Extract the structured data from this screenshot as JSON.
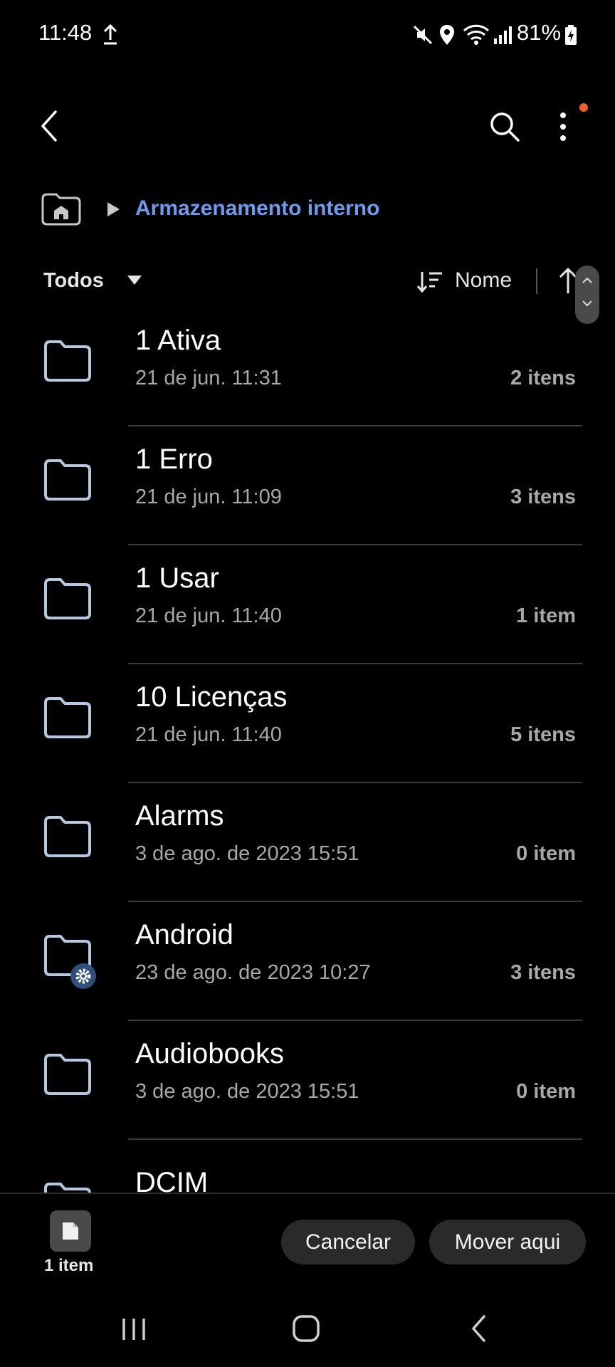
{
  "status_bar": {
    "time": "11:48",
    "battery": "81%"
  },
  "breadcrumb": {
    "location": "Armazenamento interno"
  },
  "filter": {
    "label": "Todos"
  },
  "sort": {
    "label": "Nome"
  },
  "folders": [
    {
      "name": "1 Ativa",
      "date": "21 de jun. 11:31",
      "count": "2 itens"
    },
    {
      "name": "1 Erro",
      "date": "21 de jun. 11:09",
      "count": "3 itens"
    },
    {
      "name": "1 Usar",
      "date": "21 de jun. 11:40",
      "count": "1 item"
    },
    {
      "name": "10 Licenças",
      "date": "21 de jun. 11:40",
      "count": "5 itens"
    },
    {
      "name": "Alarms",
      "date": "3 de ago. de 2023 15:51",
      "count": "0 item"
    },
    {
      "name": "Android",
      "date": "23 de ago. de 2023 10:27",
      "count": "3 itens"
    },
    {
      "name": "Audiobooks",
      "date": "3 de ago. de 2023 15:51",
      "count": "0 item"
    },
    {
      "name": "DCIM"
    }
  ],
  "bottom_bar": {
    "item_count": "1 item",
    "cancel_label": "Cancelar",
    "move_label": "Mover aqui"
  },
  "colors": {
    "accent": "#6e9bf0",
    "notification_dot": "#f25c2a",
    "folder_outline": "#b4c8e0"
  }
}
